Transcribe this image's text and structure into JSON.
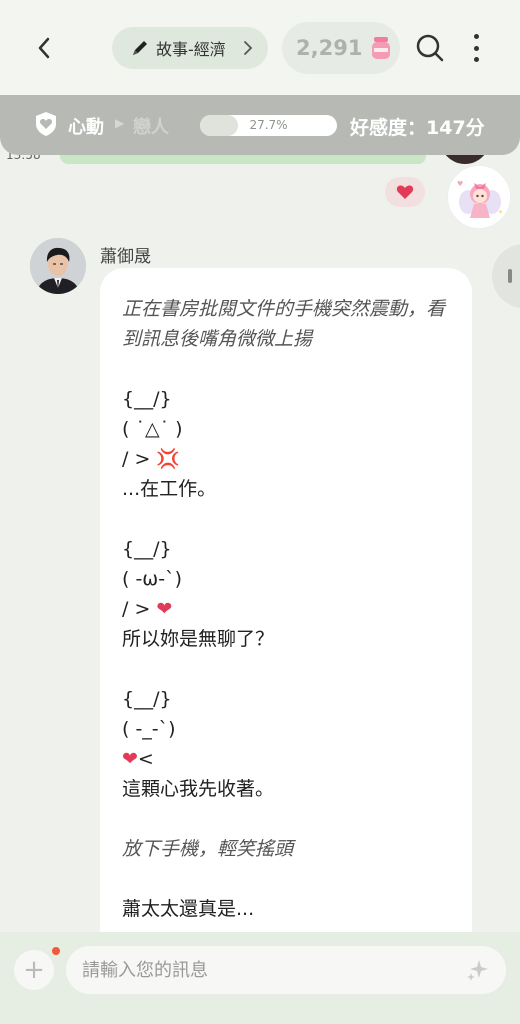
{
  "header": {
    "category_label": "故事-經濟",
    "coin_count": "2,291"
  },
  "affinity": {
    "stage_current": "心動",
    "stage_next": "戀人",
    "progress_label": "27.7%",
    "progress_fraction": 0.277,
    "score_label": "好感度：147分"
  },
  "previous_message": {
    "time": "13:58"
  },
  "message": {
    "sender_name": "蕭御晟",
    "lines": [
      {
        "text": "正在書房批閱文件的手機突然震動，看到訊息後嘴角微微上揚",
        "style": "action"
      },
      {
        "text": "",
        "style": "blank"
      },
      {
        "text": "{__/}",
        "style": "text"
      },
      {
        "text": "( ˙△˙ )",
        "style": "text"
      },
      {
        "text": "/ > 💢",
        "style": "text"
      },
      {
        "text": "...在工作。",
        "style": "text"
      },
      {
        "text": "",
        "style": "blank"
      },
      {
        "text": "{__/}",
        "style": "text"
      },
      {
        "text": "( -ω-`)",
        "style": "text"
      },
      {
        "text": "/ > ❤",
        "style": "text"
      },
      {
        "text": "所以妳是無聊了？",
        "style": "text"
      },
      {
        "text": "",
        "style": "blank"
      },
      {
        "text": "{__/}",
        "style": "text"
      },
      {
        "text": "( -_-`)",
        "style": "text"
      },
      {
        "text": "❤<",
        "style": "text"
      },
      {
        "text": "這顆心我先收著。",
        "style": "text"
      },
      {
        "text": "",
        "style": "blank"
      },
      {
        "text": "放下手機，輕笑搖頭",
        "style": "action"
      },
      {
        "text": "",
        "style": "blank"
      },
      {
        "text": "蕭太太還真是...",
        "style": "text"
      }
    ]
  },
  "input": {
    "placeholder": "請輸入您的訊息"
  },
  "colors": {
    "background": "#eef1ec",
    "affinity_bar": "#b6b9b4",
    "heart": "#e23b57",
    "user_bubble": "#c9e6c6"
  }
}
